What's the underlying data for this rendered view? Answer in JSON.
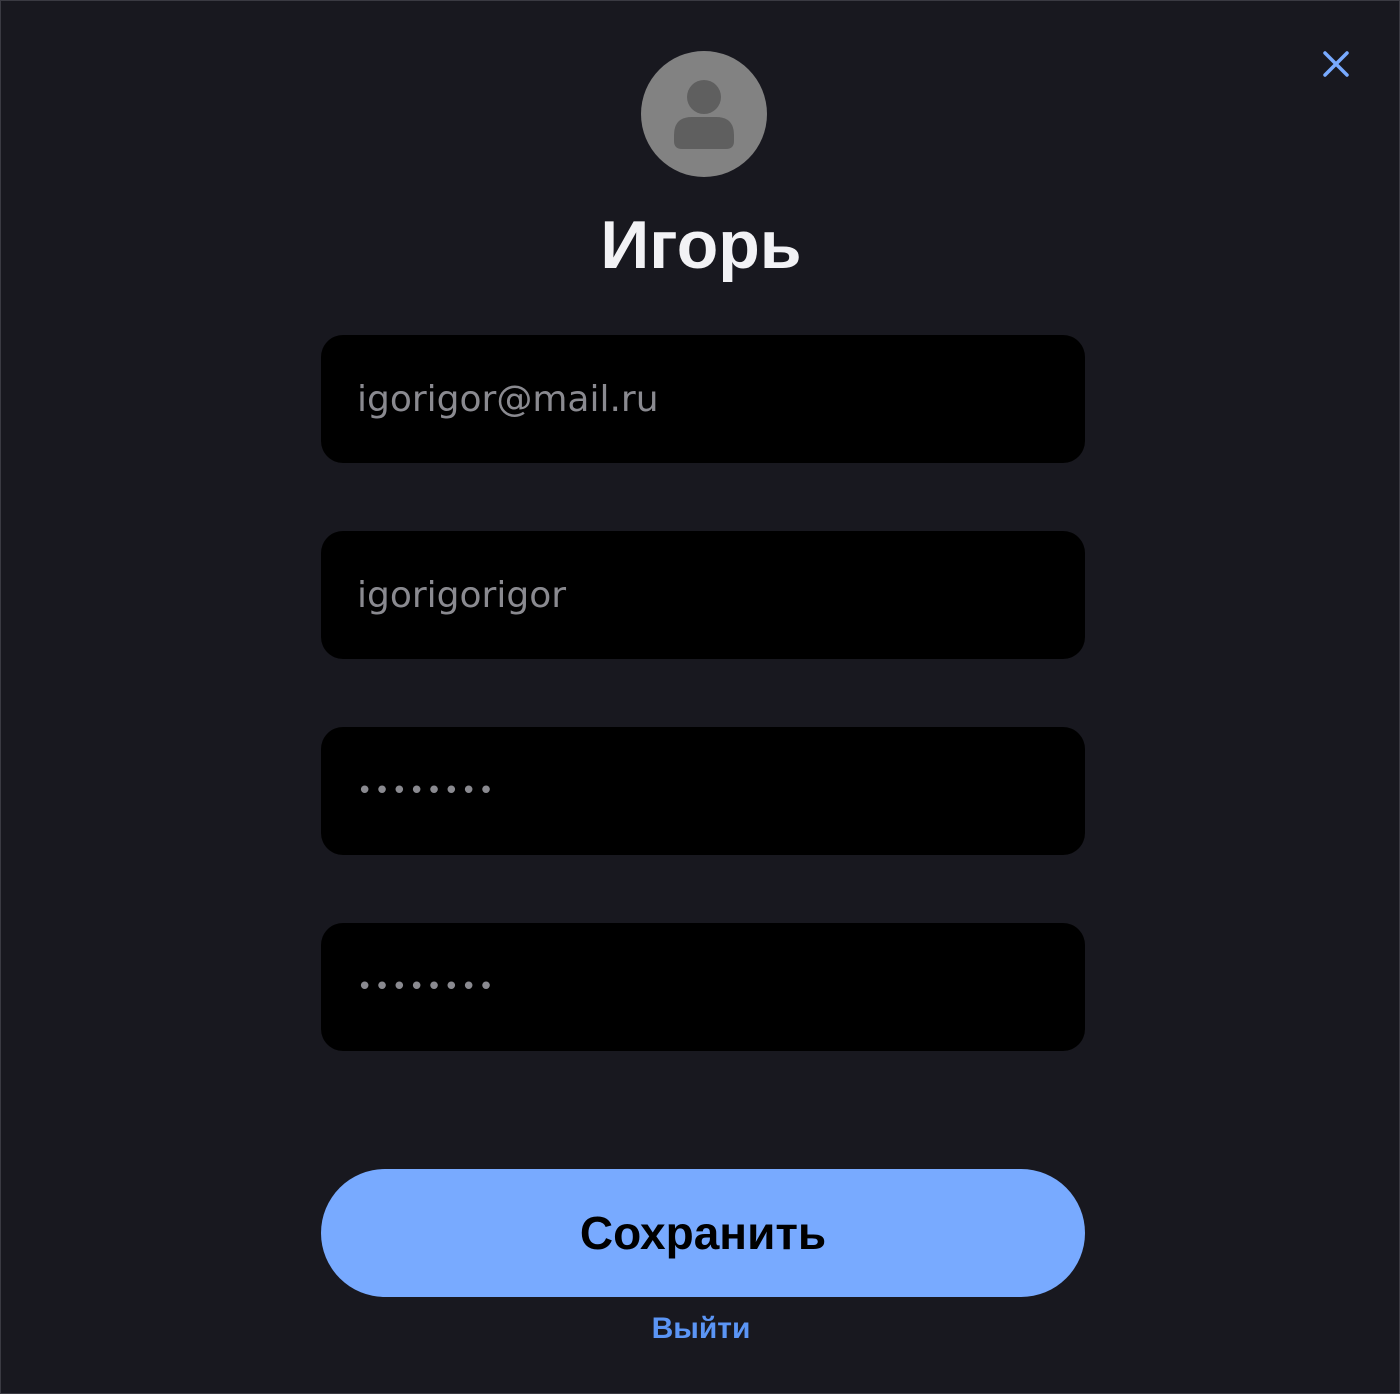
{
  "profile": {
    "name": "Игорь",
    "avatar_icon": "user-silhouette-icon",
    "avatar_color": "#828282"
  },
  "form": {
    "email_value": "igorigor@mail.ru",
    "login_value": "igorigorigor",
    "password_value": "••••••••",
    "password_confirm_value": "••••••••"
  },
  "actions": {
    "save_label": "Сохранить",
    "logout_label": "Выйти",
    "close_icon": "close-icon"
  },
  "colors": {
    "background": "#18181f",
    "field_background": "#000000",
    "accent": "#78aaff",
    "link": "#5b95f5"
  }
}
